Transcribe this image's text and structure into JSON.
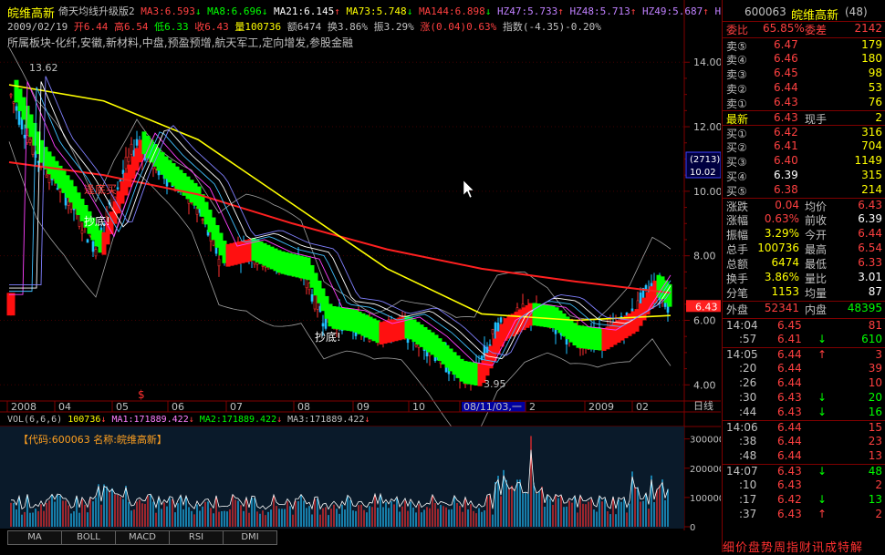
{
  "header": {
    "stock_name": "皖维高新",
    "indicator": "倚天均线升级版2",
    "ma_values": [
      {
        "label": "MA3:",
        "value": "6.593",
        "arrow": "↓",
        "color": "#ff4040"
      },
      {
        "label": "MA8:",
        "value": "6.696",
        "arrow": "↓",
        "color": "#00ff00"
      },
      {
        "label": "MA21:",
        "value": "6.145",
        "arrow": "↑",
        "color": "#ffffff"
      },
      {
        "label": "MA73:",
        "value": "5.748",
        "arrow": "↓",
        "color": "#ffff00"
      },
      {
        "label": "MA144:",
        "value": "6.898",
        "arrow": "↓",
        "color": "#ff4040"
      },
      {
        "label": "HZ47:",
        "value": "5.733",
        "arrow": "↑",
        "color": "#c080ff"
      },
      {
        "label": "HZ48:",
        "value": "5.713",
        "arrow": "↑",
        "color": "#c080ff"
      },
      {
        "label": "HZ49:",
        "value": "5.687",
        "arrow": "↑",
        "color": "#c080ff"
      },
      {
        "label": "HZ5",
        "value": "",
        "arrow": "",
        "color": "#c080ff"
      }
    ],
    "date": "2009/02/19",
    "open": "开6.44",
    "high": "高6.54",
    "low": "低6.33",
    "close": "收6.43",
    "volume": "量100736",
    "amount": "额6474",
    "turnover": "换3.86%",
    "amplitude": "振3.29%",
    "change": "涨(0.04)0.63%",
    "index": "指数(-4.35)-0.20%",
    "sector": "所属板块-化纤,安徽,新材料,中盘,预盈预增,航天军工,定向增发,参股金融"
  },
  "chart_data": {
    "type": "candlestick",
    "y_ticks": [
      "14.00",
      "12.00",
      "10.00",
      "8.00",
      "6.00",
      "4.00"
    ],
    "y_range": [
      3.5,
      14.6
    ],
    "x_ticks": [
      "2008",
      "04",
      "05",
      "06",
      "07",
      "08",
      "09",
      "10",
      "08/11/03,一",
      "2",
      "2009",
      "02"
    ],
    "price_label": "6.43",
    "highlight_box": {
      "top": "(2713)",
      "bottom": "10.02"
    },
    "annotations": {
      "high_label": "13.62",
      "low_label": "3.95",
      "bottom_labels": [
        "抄底!",
        "抄底!"
      ],
      "red_text": "逢底买",
      "dollar": "$"
    },
    "series": {
      "ma144_points": [
        [
          0,
          10.9
        ],
        [
          20,
          10.5
        ],
        [
          40,
          9.9
        ],
        [
          60,
          9.0
        ],
        [
          80,
          8.2
        ],
        [
          100,
          7.6
        ],
        [
          120,
          7.2
        ],
        [
          140,
          6.85
        ]
      ],
      "ma73_points": [
        [
          0,
          13.3
        ],
        [
          20,
          12.8
        ],
        [
          40,
          11.6
        ],
        [
          60,
          9.6
        ],
        [
          80,
          7.6
        ],
        [
          100,
          6.2
        ],
        [
          120,
          6.0
        ],
        [
          140,
          6.15
        ]
      ]
    },
    "volume": {
      "header": "VOL(6,6,6)",
      "vol": "100736",
      "ma1": "MA1:171889.422",
      "ma2": "MA2:171889.422",
      "ma3": "MA3:171889.422",
      "code_label": "【代码:600063 名称:皖维高新】",
      "y_ticks": [
        "300000",
        "200000",
        "100000",
        "0"
      ],
      "y_range": [
        0,
        330000
      ]
    }
  },
  "tabs": [
    "MA",
    "BOLL",
    "MACD",
    "RSI",
    "DMI"
  ],
  "sidebar": {
    "code": "600063",
    "name": "皖维高新",
    "count": "(48)",
    "weibi_label": "委比",
    "weibi_value": "65.85%",
    "weicha_label": "委差",
    "weicha_value": "2142",
    "sells": [
      {
        "label": "卖⑤",
        "price": "6.47",
        "vol": "179"
      },
      {
        "label": "卖④",
        "price": "6.46",
        "vol": "180"
      },
      {
        "label": "卖③",
        "price": "6.45",
        "vol": "98"
      },
      {
        "label": "卖②",
        "price": "6.44",
        "vol": "53"
      },
      {
        "label": "卖①",
        "price": "6.43",
        "vol": "76"
      }
    ],
    "latest_label": "最新",
    "latest_value": "6.43",
    "xianshou_label": "现手",
    "xianshou_value": "2",
    "buys": [
      {
        "label": "买①",
        "price": "6.42",
        "vol": "316"
      },
      {
        "label": "买②",
        "price": "6.41",
        "vol": "704"
      },
      {
        "label": "买③",
        "price": "6.40",
        "vol": "1149"
      },
      {
        "label": "买④",
        "price": "6.39",
        "vol": "315"
      },
      {
        "label": "买⑤",
        "price": "6.38",
        "vol": "214"
      }
    ],
    "stats": [
      {
        "l1": "涨跌",
        "v1": "0.04",
        "l2": "均价",
        "v2": "6.43"
      },
      {
        "l1": "涨幅",
        "v1": "0.63%",
        "l2": "前收",
        "v2": "6.39"
      },
      {
        "l1": "振幅",
        "v1": "3.29%",
        "l2": "今开",
        "v2": "6.44"
      },
      {
        "l1": "总手",
        "v1": "100736",
        "l2": "最高",
        "v2": "6.54"
      },
      {
        "l1": "总额",
        "v1": "6474",
        "l2": "最低",
        "v2": "6.33"
      },
      {
        "l1": "换手",
        "v1": "3.86%",
        "l2": "量比",
        "v2": "3.01"
      },
      {
        "l1": "分笔",
        "v1": "1153",
        "l2": "均量",
        "v2": "87"
      }
    ],
    "waipan_label": "外盘",
    "waipan_value": "52341",
    "neipan_label": "内盘",
    "neipan_value": "48395",
    "ticks": [
      {
        "time": "14:04",
        "price": "6.45",
        "vol": "81",
        "arrow": ""
      },
      {
        "time": ":57",
        "price": "6.41",
        "vol": "610",
        "arrow": "↓"
      },
      {
        "time": "14:05",
        "price": "6.44",
        "vol": "3",
        "arrow": "↑"
      },
      {
        "time": ":20",
        "price": "6.44",
        "vol": "39",
        "arrow": ""
      },
      {
        "time": ":26",
        "price": "6.44",
        "vol": "10",
        "arrow": ""
      },
      {
        "time": ":30",
        "price": "6.43",
        "vol": "20",
        "arrow": "↓"
      },
      {
        "time": ":44",
        "price": "6.43",
        "vol": "16",
        "arrow": "↓"
      },
      {
        "time": "14:06",
        "price": "6.44",
        "vol": "15",
        "arrow": ""
      },
      {
        "time": ":38",
        "price": "6.44",
        "vol": "23",
        "arrow": ""
      },
      {
        "time": ":48",
        "price": "6.44",
        "vol": "13",
        "arrow": ""
      },
      {
        "time": "14:07",
        "price": "6.43",
        "vol": "48",
        "arrow": "↓"
      },
      {
        "time": ":10",
        "price": "6.43",
        "vol": "2",
        "arrow": ""
      },
      {
        "time": ":17",
        "price": "6.42",
        "vol": "13",
        "arrow": "↓"
      },
      {
        "time": ":37",
        "price": "6.43",
        "vol": "2",
        "arrow": "↑"
      }
    ],
    "bottom_tabs": "细价盘势周指财讯成特解"
  },
  "axis_label_right": "日线"
}
